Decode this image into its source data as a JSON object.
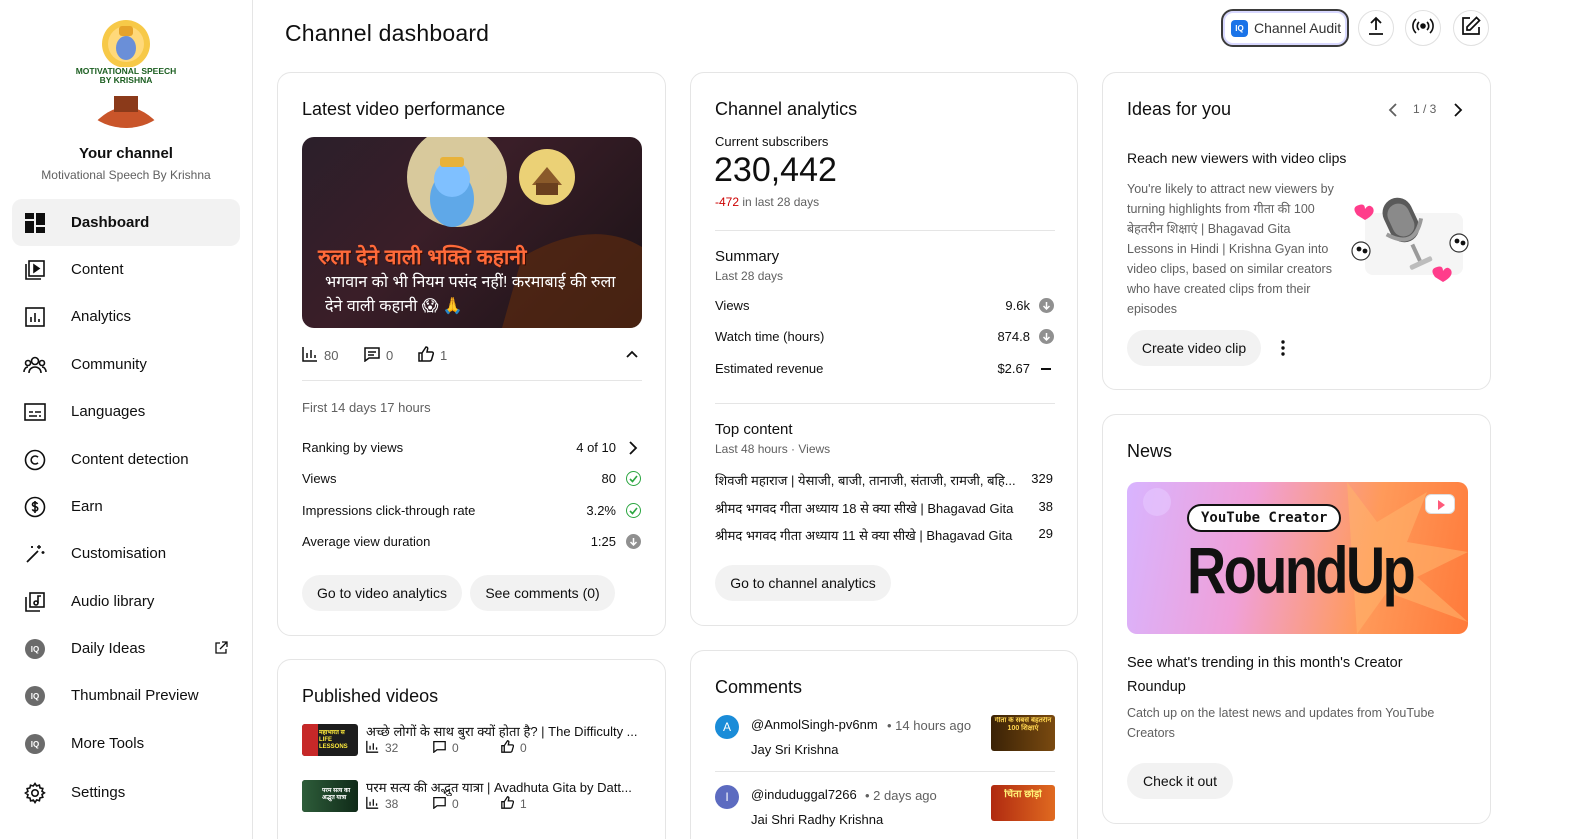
{
  "sidebar": {
    "channel_title": "Your channel",
    "channel_name": "Motivational Speech By Krishna",
    "avatar_text": "MOTIVATIONAL SPEECH BY KRISHNA",
    "items": [
      {
        "label": "Dashboard",
        "icon": "dashboard-icon"
      },
      {
        "label": "Content",
        "icon": "content-icon"
      },
      {
        "label": "Analytics",
        "icon": "analytics-icon"
      },
      {
        "label": "Community",
        "icon": "community-icon"
      },
      {
        "label": "Languages",
        "icon": "languages-icon"
      },
      {
        "label": "Content detection",
        "icon": "copyright-icon"
      },
      {
        "label": "Earn",
        "icon": "dollar-icon"
      },
      {
        "label": "Customisation",
        "icon": "magic-wand-icon"
      },
      {
        "label": "Audio library",
        "icon": "audio-library-icon"
      },
      {
        "label": "Daily Ideas",
        "icon": "iq-icon"
      },
      {
        "label": "Thumbnail Preview",
        "icon": "iq-icon"
      },
      {
        "label": "More Tools",
        "icon": "iq-icon"
      },
      {
        "label": "Settings",
        "icon": "gear-icon"
      }
    ]
  },
  "header": {
    "title": "Channel dashboard",
    "audit_badge": "IQ",
    "audit_label": "Channel Audit"
  },
  "latest": {
    "title": "Latest video performance",
    "thumb_headline": "रुला देने वाली भक्ति कहानी",
    "thumb_caption": "भगवान को भी नियम पसंद नहीं! करमाबाई की रुला देने वाली कहानी 😱 🙏",
    "views": "80",
    "comments": "0",
    "likes": "1",
    "period": "First 14 days 17 hours",
    "rows": [
      {
        "label": "Ranking by views",
        "value": "4 of 10"
      },
      {
        "label": "Views",
        "value": "80"
      },
      {
        "label": "Impressions click-through rate",
        "value": "3.2%"
      },
      {
        "label": "Average view duration",
        "value": "1:25"
      }
    ],
    "btn_analytics": "Go to video analytics",
    "btn_comments": "See comments (0)"
  },
  "analytics": {
    "title": "Channel analytics",
    "subs_label": "Current subscribers",
    "subs_value": "230,442",
    "subs_change": "-472",
    "subs_change_suffix": "in last 28 days",
    "summary_title": "Summary",
    "summary_period": "Last 28 days",
    "summary_rows": [
      {
        "label": "Views",
        "value": "9.6k"
      },
      {
        "label": "Watch time (hours)",
        "value": "874.8"
      },
      {
        "label": "Estimated revenue",
        "value": "$2.67"
      }
    ],
    "top_title": "Top content",
    "top_period": "Last 48 hours · Views",
    "top_rows": [
      {
        "title": "शिवजी महाराज | येसाजी, बाजी, तानाजी, संताजी, रामजी, बहि...",
        "views": "329"
      },
      {
        "title": "श्रीमद भगवद गीता अध्याय 18 से क्या सीखे | Bhagavad Gita ...",
        "views": "38"
      },
      {
        "title": "श्रीमद भगवद गीता अध्याय 11 से क्या सीखे | Bhagavad Gita ...",
        "views": "29"
      }
    ],
    "btn": "Go to channel analytics"
  },
  "ideas": {
    "title": "Ideas for you",
    "pager": "1 / 3",
    "heading": "Reach new viewers with video clips",
    "body": "You're likely to attract new viewers by turning highlights from गीता की 100 बेहतरीन शिक्षाएं | Bhagavad Gita Lessons in Hindi | Krishna Gyan into video clips, based on similar creators who have created clips from their episodes",
    "btn": "Create video clip"
  },
  "published": {
    "title": "Published videos",
    "videos": [
      {
        "title": "अच्छे लोगों के साथ बुरा क्यों होता है? | The Difficulty ...",
        "views": "32",
        "comments": "0",
        "likes": "0",
        "thumb_text": "महाभारत से LIFE LESSONS"
      },
      {
        "title": "परम सत्य की अद्भुत यात्रा | Avadhuta Gita by Datt...",
        "views": "38",
        "comments": "0",
        "likes": "1",
        "thumb_text": "परम सत्य की अद्भुत यात्रा"
      }
    ]
  },
  "comments": {
    "title": "Comments",
    "items": [
      {
        "initial": "A",
        "color": "#1a8cd8",
        "author": "@AnmolSingh-pv6nm",
        "time": "• 14 hours ago",
        "text": "Jay  Sri  Krishna",
        "thumb_text": "गीता के सबसे बेहतरीन 100 शिक्षाएं"
      },
      {
        "initial": "I",
        "color": "#5c6bc0",
        "author": "@induduggal7266",
        "time": "• 2 days ago",
        "text": "Jai Shri Radhy Krishna",
        "thumb_text": "चिंता छोड़ो"
      }
    ]
  },
  "news": {
    "title": "News",
    "banner_tag": "YouTube Creator",
    "banner_title": "RoundUp",
    "heading": "See what's trending in this month's Creator Roundup",
    "body": "Catch up on the latest news and updates from YouTube Creators",
    "btn": "Check it out"
  },
  "colors": {
    "negative": "#cc0000",
    "ok": "#2ba640",
    "accent": "#065fd4"
  }
}
